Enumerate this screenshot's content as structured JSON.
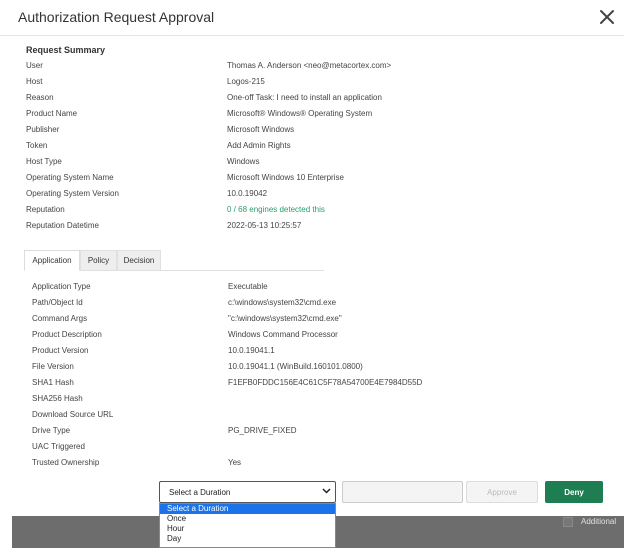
{
  "modal": {
    "title": "Authorization Request Approval",
    "close_icon": "close-icon"
  },
  "summary": {
    "title": "Request Summary",
    "rows": [
      {
        "label": "User",
        "value": "Thomas A. Anderson <neo@metacortex.com>"
      },
      {
        "label": "Host",
        "value": "Logos-215"
      },
      {
        "label": "Reason",
        "value": "One-off Task: I need to install an application"
      },
      {
        "label": "Product Name",
        "value": "Microsoft® Windows® Operating System"
      },
      {
        "label": "Publisher",
        "value": "Microsoft Windows"
      },
      {
        "label": "Token",
        "value": "Add Admin Rights"
      },
      {
        "label": "Host Type",
        "value": "Windows"
      },
      {
        "label": "Operating System Name",
        "value": "Microsoft Windows 10 Enterprise"
      },
      {
        "label": "Operating System Version",
        "value": "10.0.19042"
      },
      {
        "label": "Reputation",
        "value": "0 / 68 engines detected this"
      },
      {
        "label": "Reputation Datetime",
        "value": "2022-05-13 10:25:57"
      }
    ],
    "reputation_color": "#2a9d6a"
  },
  "tabs": [
    {
      "label": "Application",
      "active": true
    },
    {
      "label": "Policy",
      "active": false
    },
    {
      "label": "Decision",
      "active": false
    }
  ],
  "application": {
    "rows": [
      {
        "label": "Application Type",
        "value": "Executable"
      },
      {
        "label": "Path/Object Id",
        "value": "c:\\windows\\system32\\cmd.exe"
      },
      {
        "label": "Command Args",
        "value": "\"c:\\windows\\system32\\cmd.exe\""
      },
      {
        "label": "Product Description",
        "value": "Windows Command Processor"
      },
      {
        "label": "Product Version",
        "value": "10.0.19041.1"
      },
      {
        "label": "File Version",
        "value": "10.0.19041.1 (WinBuild.160101.0800)"
      },
      {
        "label": "SHA1 Hash",
        "value": "F1EFB0FDDC156E4C61C5F78A54700E4E7984D55D"
      },
      {
        "label": "SHA256 Hash",
        "value": ""
      },
      {
        "label": "Download Source URL",
        "value": ""
      },
      {
        "label": "Drive Type",
        "value": "PG_DRIVE_FIXED"
      },
      {
        "label": "UAC Triggered",
        "value": ""
      },
      {
        "label": "Trusted Ownership",
        "value": "Yes"
      }
    ]
  },
  "actions": {
    "duration_selected": "Select a Duration",
    "duration_options": [
      "Select a Duration",
      "Once",
      "Hour",
      "Day"
    ],
    "comment_value": "",
    "approve_label": "Approve",
    "deny_label": "Deny",
    "deny_color": "#1e7e52"
  },
  "background": {
    "additional_label": "Additional"
  }
}
